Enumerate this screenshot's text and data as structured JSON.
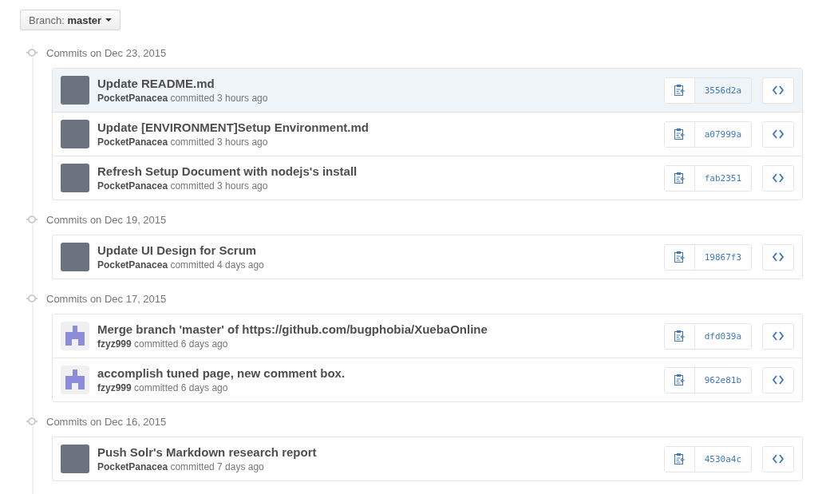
{
  "branch_button": {
    "label": "Branch: **master**"
  },
  "commit_groups": [
    {
      "heading": "Commits on Dec 23, 2015",
      "commits": [
        {
          "message": "Update README.md",
          "meta": "**PocketPanacea** committed 3 hours ago",
          "kind": "photo",
          "sha": "3556d2a",
          "highlighted": true
        },
        {
          "message": "Update [ENVIRONMENT]Setup Environment.md",
          "meta": "**PocketPanacea** committed 3 hours ago",
          "kind": "photo",
          "sha": "a07999a",
          "highlighted": false
        },
        {
          "message": "Refresh Setup Document with nodejs's install",
          "meta": "**PocketPanacea** committed 3 hours ago",
          "kind": "photo",
          "sha": "fab2351",
          "highlighted": false
        }
      ]
    },
    {
      "heading": "Commits on Dec 19, 2015",
      "commits": [
        {
          "message": "Update UI Design for Scrum",
          "meta": "**PocketPanacea** committed 4 days ago",
          "kind": "photo",
          "sha": "19867f3",
          "highlighted": false
        }
      ]
    },
    {
      "heading": "Commits on Dec 17, 2015",
      "commits": [
        {
          "message": "Merge branch 'master' of https://github.com/bugphobia/XuebaOnline",
          "meta": "**fzyz999** committed 6 days ago",
          "kind": "identicon",
          "sha": "dfd039a",
          "highlighted": false
        },
        {
          "message": "accomplish tuned page, new comment box.",
          "meta": "**fzyz999** committed 6 days ago",
          "kind": "identicon",
          "sha": "962e81b",
          "highlighted": false
        }
      ]
    },
    {
      "heading": "Commits on Dec 16, 2015",
      "commits": [
        {
          "message": "Push Solr's Markdown research report",
          "meta": "**PocketPanacea** committed 7 days ago",
          "kind": "photo",
          "sha": "4530a4c",
          "highlighted": false
        }
      ]
    }
  ]
}
